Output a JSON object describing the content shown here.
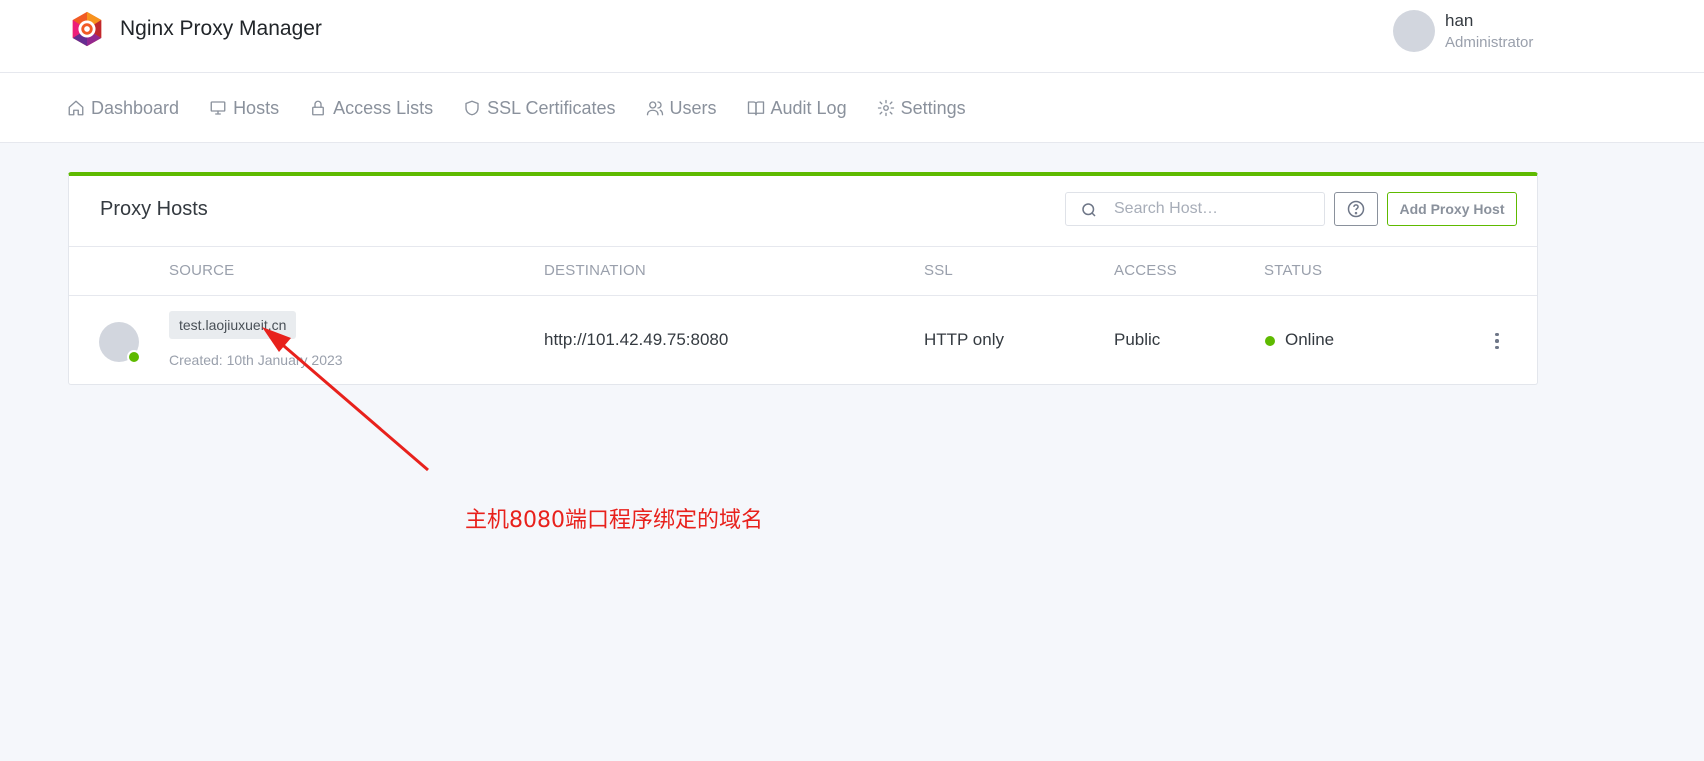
{
  "app": {
    "name": "Nginx Proxy Manager"
  },
  "user": {
    "name": "han",
    "role": "Administrator"
  },
  "nav": [
    {
      "label": "Dashboard",
      "icon": "home-icon"
    },
    {
      "label": "Hosts",
      "icon": "monitor-icon"
    },
    {
      "label": "Access Lists",
      "icon": "lock-icon"
    },
    {
      "label": "SSL Certificates",
      "icon": "shield-icon"
    },
    {
      "label": "Users",
      "icon": "users-icon"
    },
    {
      "label": "Audit Log",
      "icon": "book-icon"
    },
    {
      "label": "Settings",
      "icon": "gear-icon"
    }
  ],
  "card": {
    "title": "Proxy Hosts",
    "search_placeholder": "Search Host…",
    "add_button": "Add Proxy Host",
    "accent_color": "#5eba00"
  },
  "table": {
    "columns": [
      "SOURCE",
      "DESTINATION",
      "SSL",
      "ACCESS",
      "STATUS"
    ],
    "rows": [
      {
        "source": "test.laojiuxueit.cn",
        "created": "Created: 10th January 2023",
        "destination": "http://101.42.49.75:8080",
        "ssl": "HTTP only",
        "access": "Public",
        "status": "Online"
      }
    ]
  },
  "annotation": {
    "text": "主机8080端口程序绑定的域名",
    "color": "#e8211c"
  }
}
